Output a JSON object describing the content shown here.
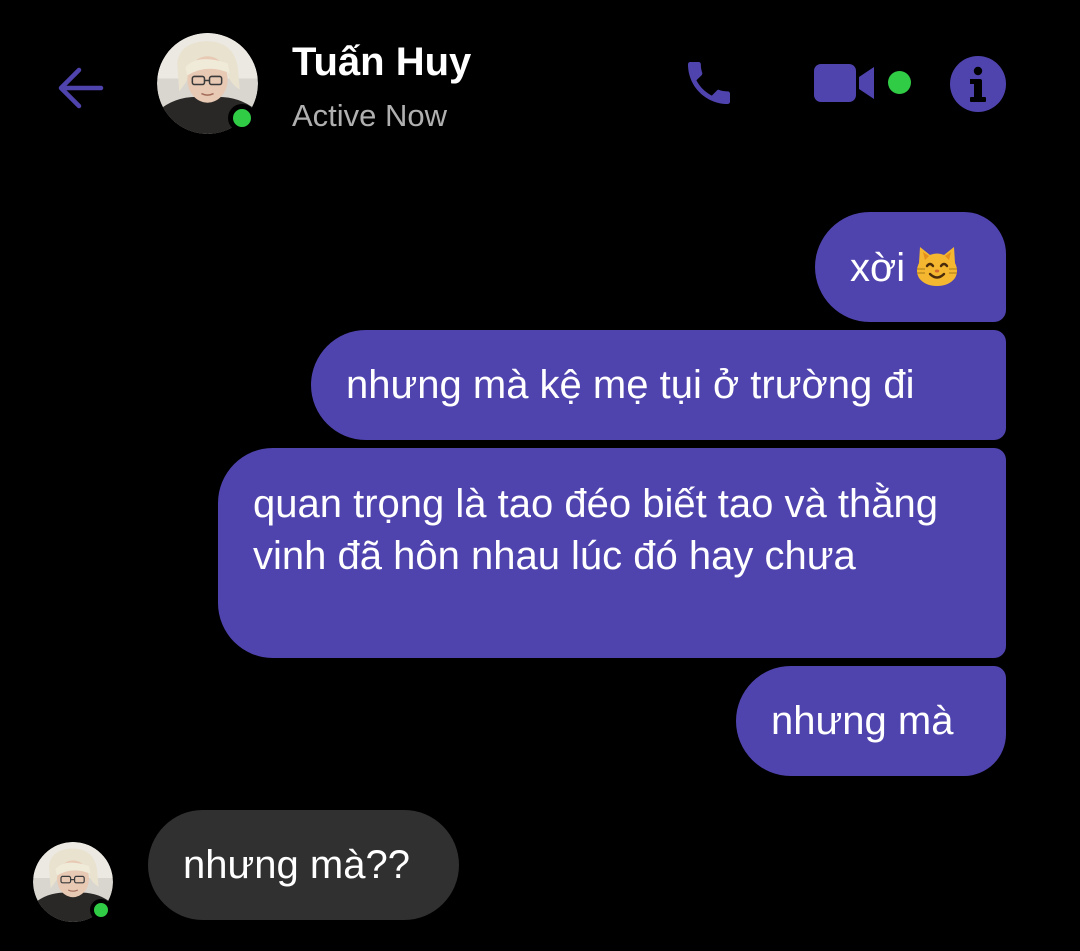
{
  "theme": {
    "accent": "#4f43ae",
    "outgoing_bubble": "#4f43ae",
    "incoming_bubble": "#303030",
    "online_green": "#31cc46",
    "status_text": "#b0b0b0",
    "background": "#000000"
  },
  "header": {
    "back_icon": "arrow-left-icon",
    "contact_name": "Tuấn Huy",
    "contact_status": "Active Now",
    "actions": [
      {
        "name": "voice-call",
        "icon": "phone-icon"
      },
      {
        "name": "video-call",
        "icon": "video-camera-icon"
      },
      {
        "name": "conversation-info",
        "icon": "info-icon"
      }
    ]
  },
  "messages": [
    {
      "direction": "outgoing",
      "text": "xời",
      "emoji": "smiling-cat-icon"
    },
    {
      "direction": "outgoing",
      "text": "nhưng mà kệ mẹ tụi ở trường đi"
    },
    {
      "direction": "outgoing",
      "text": "quan trọng là tao đéo biết tao và thằng vinh đã hôn nhau lúc đó hay chưa"
    },
    {
      "direction": "outgoing",
      "text": "nhưng mà"
    },
    {
      "direction": "incoming",
      "text": "nhưng mà??"
    }
  ]
}
